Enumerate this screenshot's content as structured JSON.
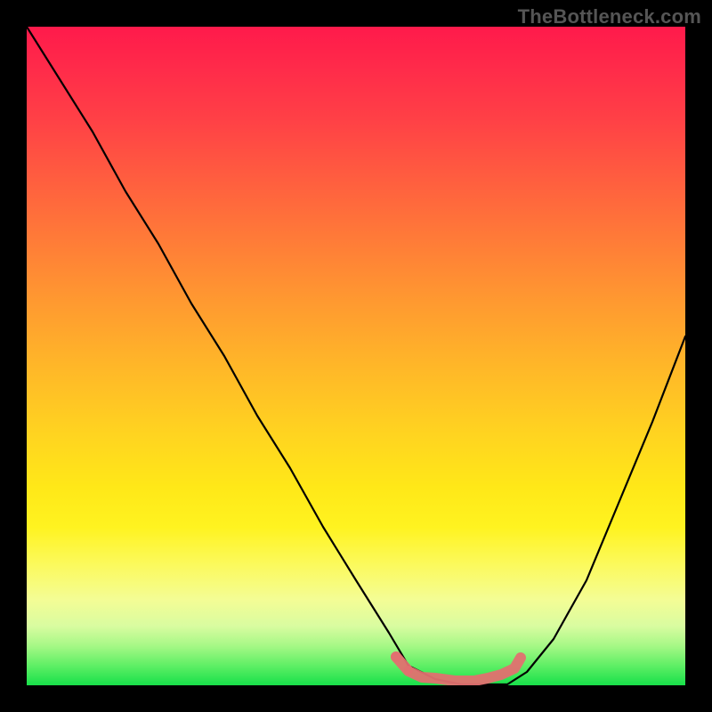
{
  "watermark": "TheBottleneck.com",
  "chart_data": {
    "type": "line",
    "title": "",
    "xlabel": "",
    "ylabel": "",
    "xlim": [
      0,
      100
    ],
    "ylim": [
      0,
      100
    ],
    "grid": false,
    "legend": false,
    "background_gradient": {
      "orientation": "vertical",
      "stops": [
        {
          "pos": 0.0,
          "color": "#ff1a4b"
        },
        {
          "pos": 0.32,
          "color": "#ff7a38"
        },
        {
          "pos": 0.62,
          "color": "#ffd420"
        },
        {
          "pos": 0.82,
          "color": "#fbfa60"
        },
        {
          "pos": 0.94,
          "color": "#a6f886"
        },
        {
          "pos": 1.0,
          "color": "#18e04a"
        }
      ]
    },
    "series": [
      {
        "name": "bottleneck-curve",
        "color": "#000000",
        "x": [
          0,
          5,
          10,
          15,
          20,
          25,
          30,
          35,
          40,
          45,
          50,
          55,
          58,
          62,
          66,
          70,
          73,
          76,
          80,
          85,
          90,
          95,
          100
        ],
        "y": [
          100,
          92,
          84,
          75,
          67,
          58,
          50,
          41,
          33,
          24,
          16,
          8,
          3,
          1,
          0,
          0,
          0,
          2,
          7,
          16,
          28,
          40,
          53
        ]
      },
      {
        "name": "sweet-spot-marker",
        "color": "#e17070",
        "x": [
          56,
          58,
          60,
          62,
          65,
          68,
          70,
          72,
          74,
          75
        ],
        "y": [
          4,
          2,
          1,
          1,
          0.5,
          0.5,
          1,
          1.5,
          2.5,
          4
        ]
      }
    ],
    "annotations": []
  }
}
